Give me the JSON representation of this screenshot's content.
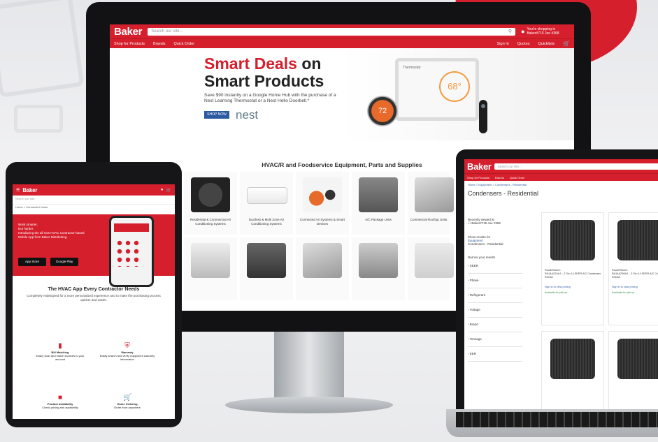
{
  "brand": {
    "name": "Baker",
    "accent": "#d51f2d",
    "link": "#2c5aa0"
  },
  "desktop": {
    "search_placeholder": "Search our site...",
    "shipping_line1": "You're shopping in",
    "shipping_line2": "Baker#715 Joe #368",
    "nav": [
      "Shop for Products",
      "Brands",
      "Quick Order"
    ],
    "nav_right": [
      "Sign In",
      "Quotes",
      "Quicklists"
    ],
    "hero": {
      "title_red": "Smart Deals",
      "title_rest": "on",
      "title_line2": "Smart Products",
      "subtitle": "Save $90 instantly on a Google Home Hub with the purchase of a Nest Learning Thermostat or a Nest Hello Doorbell.*",
      "cta": "SHOP NOW",
      "brand_mark": "nest",
      "hub_temp": "68°",
      "hub_label": "Thermostat",
      "thermostat_temp": "72"
    },
    "section_title": "HVAC/R and Foodservice Equipment, Parts and Supplies",
    "categories": [
      {
        "label": "Residential & Commercial Air Conditioning Systems"
      },
      {
        "label": "Ductless & Multi Zone Air Conditioning Systems"
      },
      {
        "label": "Connected Air Systems & Smart Devices"
      },
      {
        "label": "A/C Package Units"
      },
      {
        "label": "Commercial Rooftop Units"
      },
      {
        "label": ""
      },
      {
        "label": ""
      },
      {
        "label": ""
      },
      {
        "label": ""
      },
      {
        "label": ""
      }
    ]
  },
  "tablet": {
    "search_placeholder": "Search our site...",
    "breadcrumb": "Home > Connected Home",
    "banner_lines": [
      "Work smarter,",
      "Not harder.",
      "Introducing the all new HVAC Contractor-based",
      "Mobile App from Baker Distributing."
    ],
    "badges": [
      "App Store",
      "Google Play"
    ],
    "title": "The HVAC App Every Contractor Needs",
    "subtitle": "Completely redesigned for a more personalized experience and to make the purchasing process quicker and easier.",
    "features": [
      {
        "name": "Bill Matching",
        "text": "Easily scan and match invoices to your account"
      },
      {
        "name": "Warranty",
        "text": "Easily search and verify equipment warranty information"
      },
      {
        "name": "Product availability",
        "text": "Check pricing and availability"
      },
      {
        "name": "Home Ordering",
        "text": "Order from anywhere"
      }
    ]
  },
  "laptop": {
    "search_placeholder": "Search our site...",
    "nav": [
      "Shop for Products",
      "Brands",
      "Quick Order"
    ],
    "breadcrumb": "Home > Equipment > Condensers - Residential",
    "page_title": "Condensers - Residential",
    "side_items": [
      "Recently viewed at",
      "Baker#715 Joe #368",
      "Show results for",
      "Equipment",
      "Condensers - Residential",
      "Narrow your results",
      "SEER",
      "Phase",
      "Refrigerant",
      "Voltage",
      "Brand",
      "Tonnage",
      "EER"
    ],
    "products": [
      {
        "brand": "Ruud/Rheem",
        "title": "RA14AZ24AJ – 2 Ton 14 SEER A/C Condenser, R410A",
        "price": "Sign in to view pricing",
        "availability": "Available for pick-up"
      },
      {
        "brand": "Ruud/Rheem",
        "title": "RA14AZ36AJ – 3 Ton 14 SEER A/C Condenser, R410A",
        "price": "Sign in to view pricing",
        "availability": "Available for pick-up"
      }
    ]
  }
}
